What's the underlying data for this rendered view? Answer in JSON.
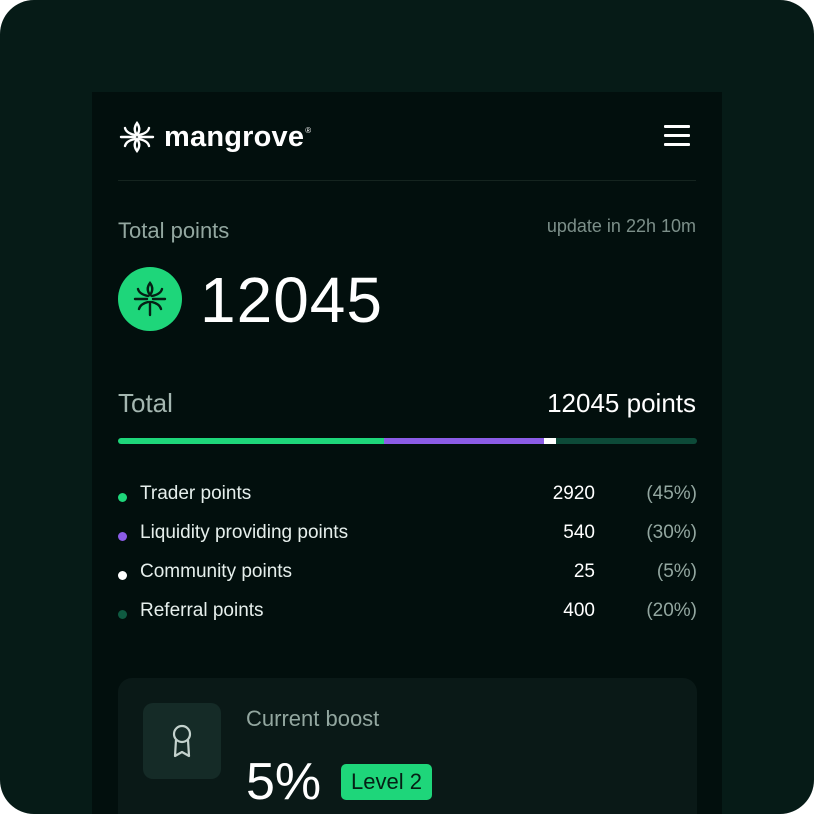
{
  "app": {
    "brand": "mangrove",
    "brand_mark": "®"
  },
  "header": {
    "menu_icon": "hamburger-menu-icon"
  },
  "summary": {
    "label": "Total points",
    "update_text": "update in 22h 10m",
    "total_value": "12045",
    "badge_icon": "mangrove-leaf-icon"
  },
  "total_row": {
    "label": "Total",
    "value": "12045 points"
  },
  "progress": {
    "segments": [
      {
        "name": "trader",
        "fraction": 0.46,
        "color": "#1ed67a"
      },
      {
        "name": "liquidity",
        "fraction": 0.275,
        "color": "#8b5ce6"
      },
      {
        "name": "community",
        "fraction": 0.022,
        "color": "#ffffff"
      },
      {
        "name": "referral",
        "fraction": 0.243,
        "color": "#0d4a38"
      }
    ]
  },
  "breakdown": [
    {
      "label": "Trader points",
      "value": "2920",
      "pct": "(45%)",
      "color": "#1ed67a"
    },
    {
      "label": "Liquidity providing points",
      "value": "540",
      "pct": "(30%)",
      "color": "#8b5ce6"
    },
    {
      "label": "Community points",
      "value": "25",
      "pct": "(5%)",
      "color": "#ffffff"
    },
    {
      "label": "Referral points",
      "value": "400",
      "pct": "(20%)",
      "color": "#0f5a41"
    }
  ],
  "boost": {
    "label": "Current boost",
    "value": "5%",
    "level": "Level 2",
    "icon": "award-ribbon-icon"
  }
}
